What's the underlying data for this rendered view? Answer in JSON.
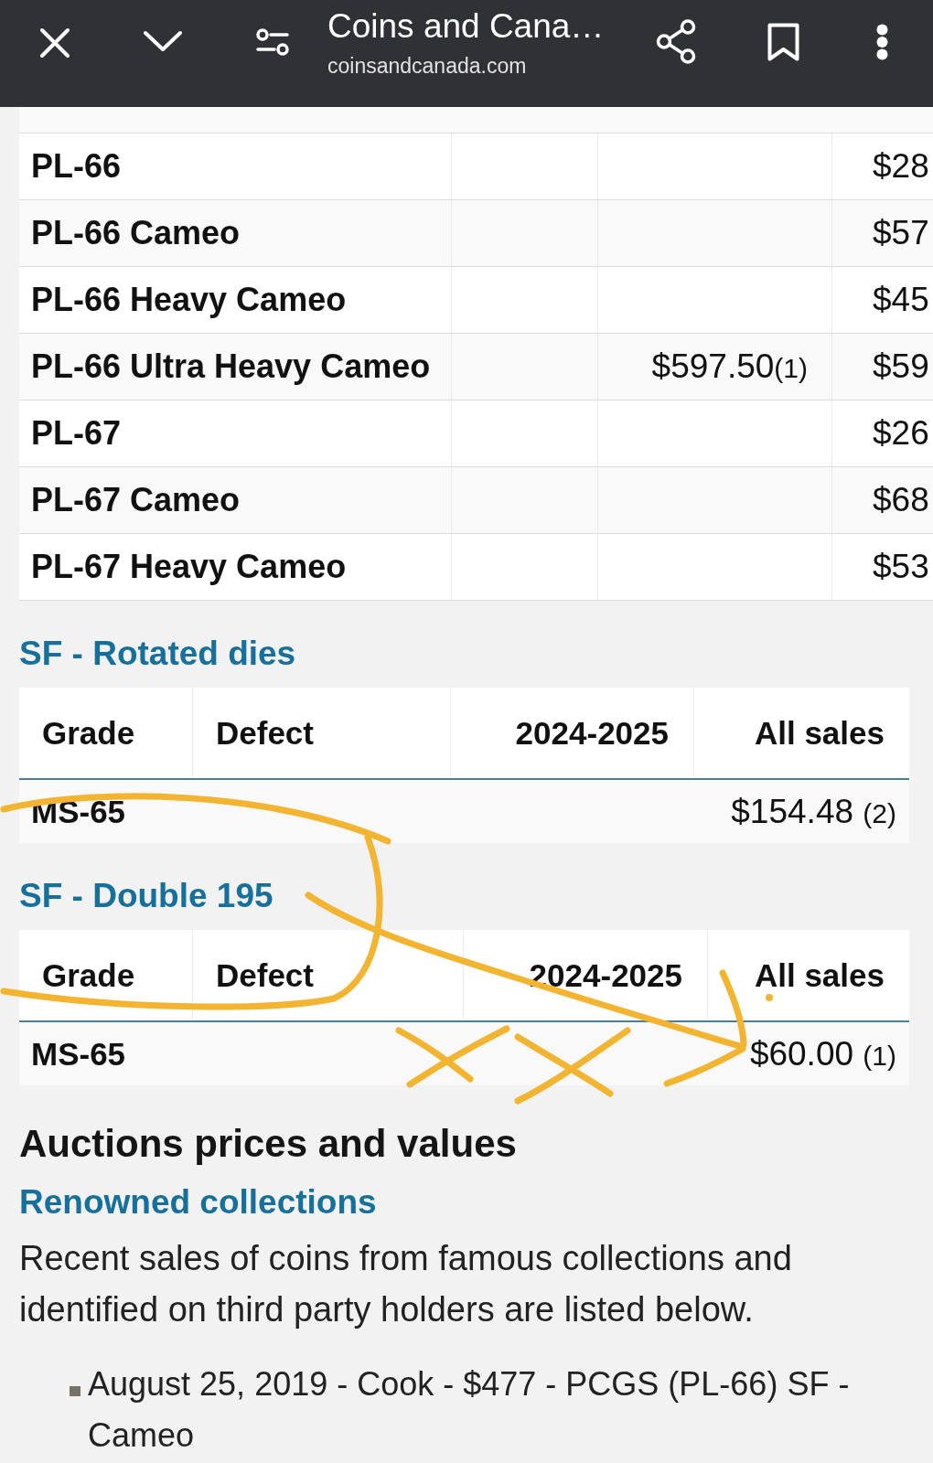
{
  "browser_bar": {
    "title": "Coins and Cana…",
    "url": "coinsandcanada.com"
  },
  "price_table": {
    "rows": [
      {
        "column_1": "PL-66",
        "column_4": "$28"
      },
      {
        "column_1": "PL-66 Cameo",
        "column_4": "$57"
      },
      {
        "column_1": "PL-66 Heavy Cameo",
        "column_4": "$45"
      },
      {
        "column_1": "PL-66 Ultra Heavy Cameo",
        "column_3": "$597.50",
        "column_3_count": "(1)",
        "column_4": "$59"
      },
      {
        "column_1": "PL-67",
        "column_4": "$26"
      },
      {
        "column_1": "PL-67 Cameo",
        "column_4": "$68"
      },
      {
        "column_1": "PL-67 Heavy Cameo",
        "column_4": "$53"
      }
    ]
  },
  "variety_sections": [
    {
      "title": "SF - Rotated dies",
      "columns": [
        "Grade",
        "Defect",
        "2024-2025",
        "All sales"
      ],
      "rows": [
        {
          "grade": "MS-65",
          "all_sales": "$154.48",
          "all_sales_count": "(2)"
        }
      ]
    },
    {
      "title": "SF - Double 195",
      "columns": [
        "Grade",
        "Defect",
        "2024-2025",
        "All sales"
      ],
      "rows": [
        {
          "grade": "MS-65",
          "all_sales": "$60.00",
          "all_sales_count": "(1)"
        }
      ]
    }
  ],
  "auctions": {
    "heading": "Auctions prices and values",
    "subheading": "Renowned collections",
    "intro": "Recent sales of coins from famous collections and identified on third party holders are listed below.",
    "sales": [
      "August 25, 2019 - Cook - $477 - PCGS (PL-66) SF - Cameo"
    ]
  }
}
